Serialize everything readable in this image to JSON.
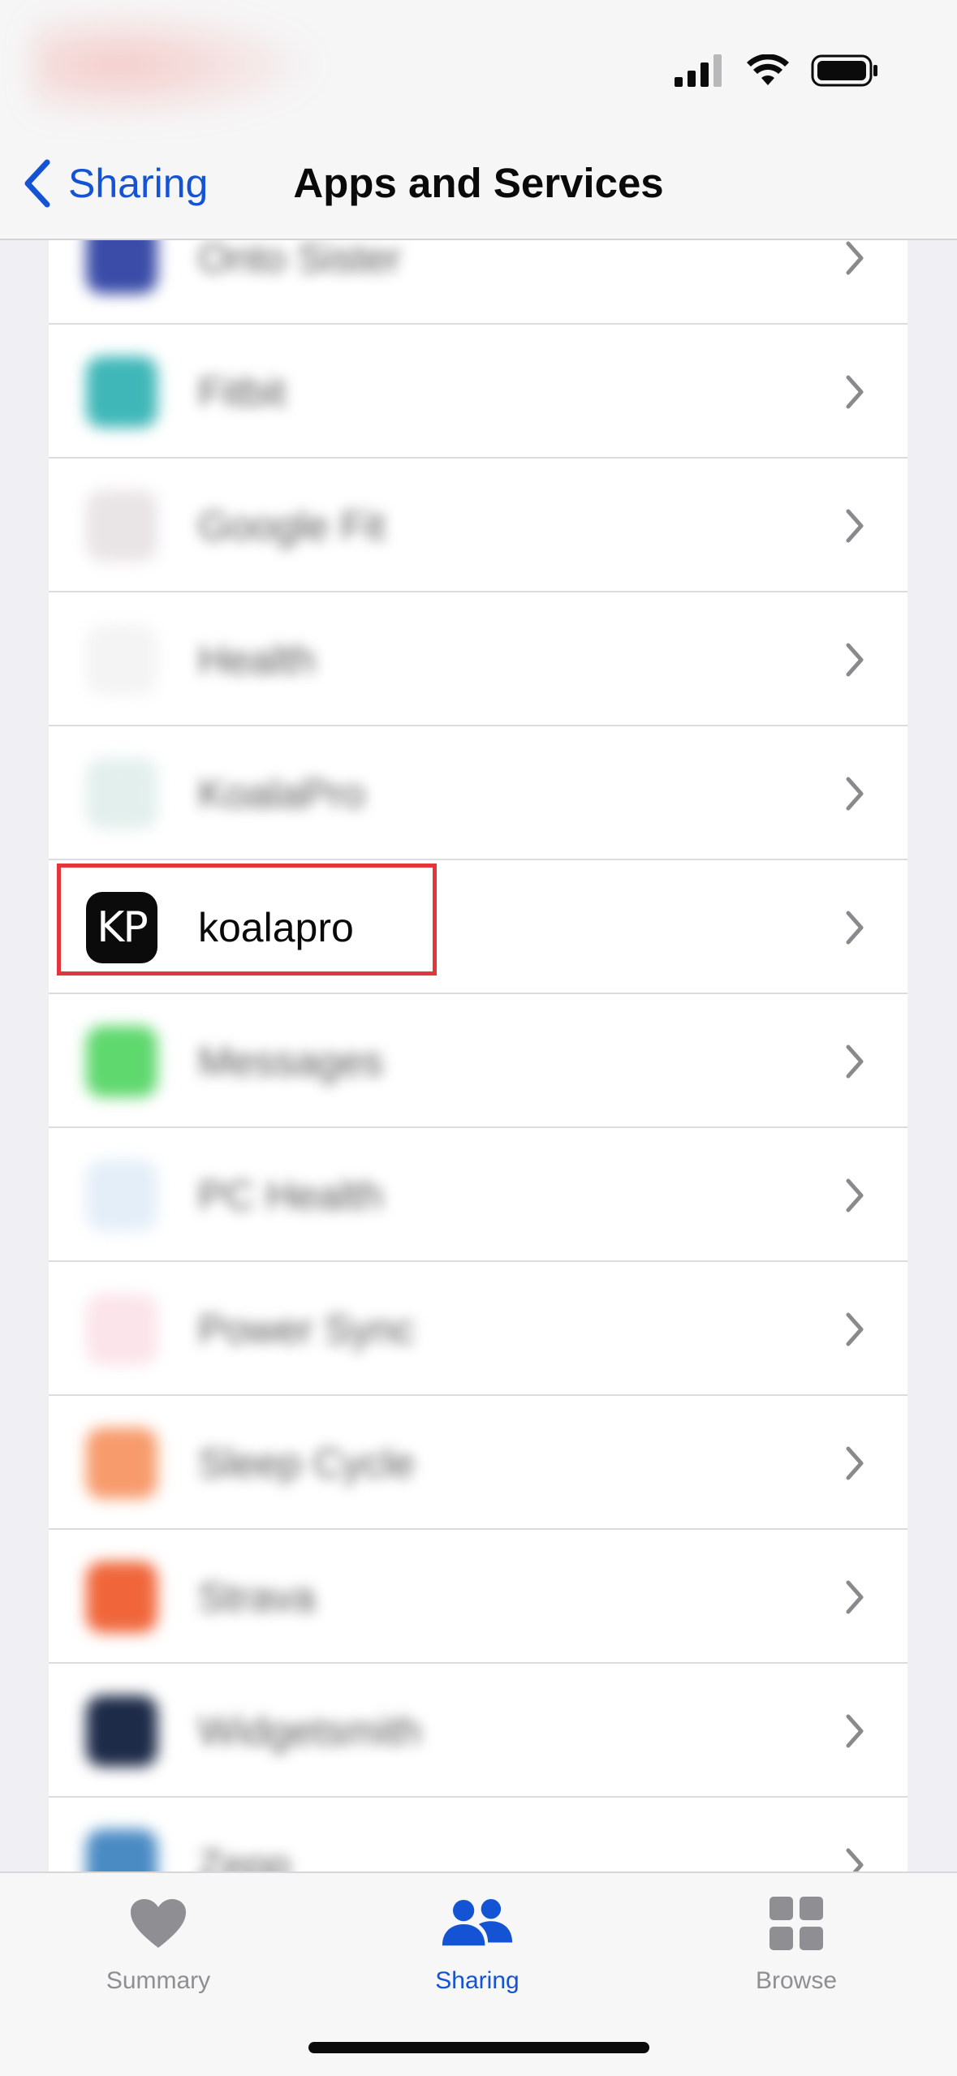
{
  "nav": {
    "back_label": "Sharing",
    "title": "Apps and Services"
  },
  "list": {
    "items": [
      {
        "label": "Onto Sister",
        "icon": "app-icon-dark-blue",
        "color": "#3a4ca8",
        "blurred": true
      },
      {
        "label": "Fitbit",
        "icon": "app-icon-teal",
        "color": "#3fb7b8",
        "blurred": true
      },
      {
        "label": "Google Fit",
        "icon": "app-icon-google-fit",
        "color": "#e9e4e6",
        "blurred": true
      },
      {
        "label": "Health",
        "icon": "app-icon-health-heart",
        "color": "#f4f4f4",
        "blurred": true
      },
      {
        "label": "KoalaPro",
        "icon": "app-icon-feather",
        "color": "#e3efec",
        "blurred": true
      },
      {
        "label": "koalapro",
        "icon": "koalapro-icon",
        "icon_text": "KP",
        "color": "#0b0b0b",
        "blurred": false
      },
      {
        "label": "Messages",
        "icon": "app-icon-green",
        "color": "#5fd86e",
        "blurred": true
      },
      {
        "label": "PC Health",
        "icon": "app-icon-pc-health",
        "color": "#e4eef8",
        "blurred": true
      },
      {
        "label": "Power Sync",
        "icon": "app-icon-pink-heart",
        "color": "#fbe4ea",
        "blurred": true
      },
      {
        "label": "Sleep Cycle",
        "icon": "app-icon-orange",
        "color": "#f79b6c",
        "blurred": true
      },
      {
        "label": "Strava",
        "icon": "app-icon-strava",
        "color": "#f0663a",
        "blurred": true
      },
      {
        "label": "Widgetsmith",
        "icon": "app-icon-navy",
        "color": "#1d2a48",
        "blurred": true
      },
      {
        "label": "Zepp",
        "icon": "app-icon-zepp",
        "color": "#4a8bc4",
        "blurred": true
      }
    ]
  },
  "tabs": [
    {
      "label": "Summary",
      "icon": "heart-icon",
      "active": false
    },
    {
      "label": "Sharing",
      "icon": "people-icon",
      "active": true
    },
    {
      "label": "Browse",
      "icon": "grid-icon",
      "active": false
    }
  ],
  "colors": {
    "accent": "#1453d3",
    "highlight": "#e2363a",
    "inactive_tab": "#8e8e93"
  }
}
